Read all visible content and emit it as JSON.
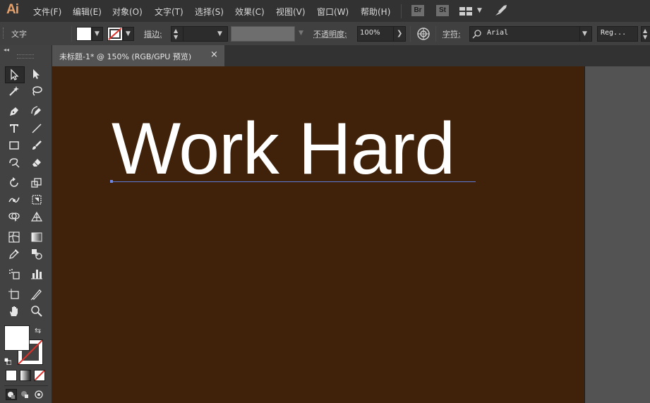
{
  "app": {
    "logo": "Ai"
  },
  "menu": [
    "文件(F)",
    "编辑(E)",
    "对象(O)",
    "文字(T)",
    "选择(S)",
    "效果(C)",
    "视图(V)",
    "窗口(W)",
    "帮助(H)"
  ],
  "menubar_buttons": {
    "bridge": "Br",
    "stock": "St"
  },
  "control": {
    "selection_label": "文字",
    "stroke_label": "描边:",
    "opacity_label": "不透明度:",
    "opacity_value": "100%",
    "char_label": "字符:",
    "font_family": "Arial",
    "font_style": "Reg..."
  },
  "tab": {
    "title": "未标题-1* @ 150% (RGB/GPU 预览)",
    "close": "×"
  },
  "artboard": {
    "text": "Work Hard",
    "background": "#40220a",
    "text_color": "#ffffff"
  },
  "colors": {
    "fill": "#ffffff",
    "stroke": "none",
    "accent_selection": "#5c7bd9"
  }
}
